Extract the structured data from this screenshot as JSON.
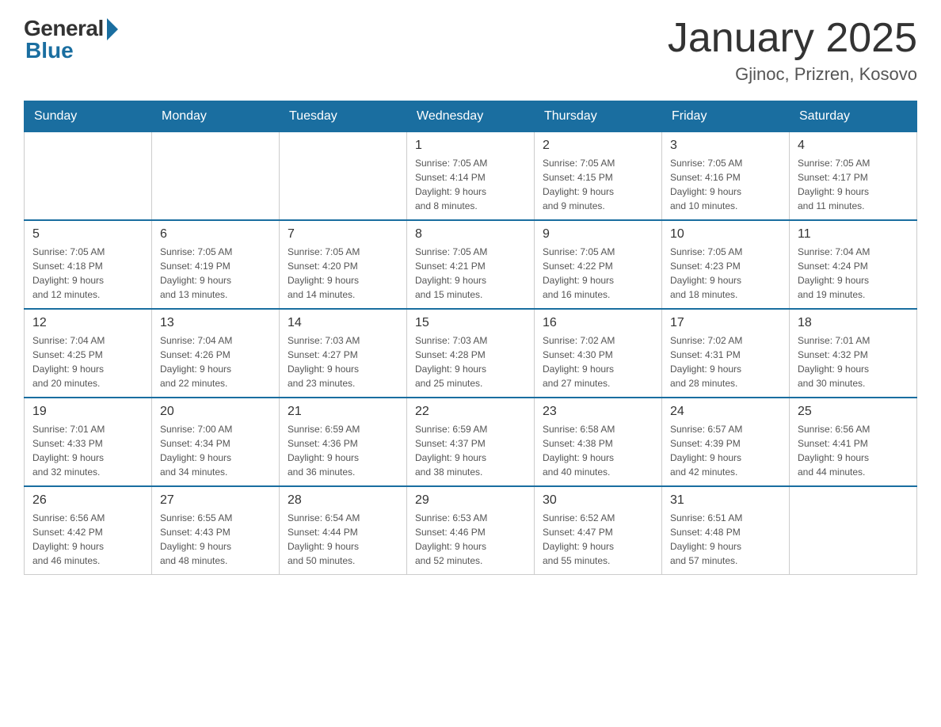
{
  "logo": {
    "general": "General",
    "blue": "Blue"
  },
  "title": "January 2025",
  "location": "Gjinoc, Prizren, Kosovo",
  "days_of_week": [
    "Sunday",
    "Monday",
    "Tuesday",
    "Wednesday",
    "Thursday",
    "Friday",
    "Saturday"
  ],
  "weeks": [
    [
      {
        "day": "",
        "info": ""
      },
      {
        "day": "",
        "info": ""
      },
      {
        "day": "",
        "info": ""
      },
      {
        "day": "1",
        "info": "Sunrise: 7:05 AM\nSunset: 4:14 PM\nDaylight: 9 hours\nand 8 minutes."
      },
      {
        "day": "2",
        "info": "Sunrise: 7:05 AM\nSunset: 4:15 PM\nDaylight: 9 hours\nand 9 minutes."
      },
      {
        "day": "3",
        "info": "Sunrise: 7:05 AM\nSunset: 4:16 PM\nDaylight: 9 hours\nand 10 minutes."
      },
      {
        "day": "4",
        "info": "Sunrise: 7:05 AM\nSunset: 4:17 PM\nDaylight: 9 hours\nand 11 minutes."
      }
    ],
    [
      {
        "day": "5",
        "info": "Sunrise: 7:05 AM\nSunset: 4:18 PM\nDaylight: 9 hours\nand 12 minutes."
      },
      {
        "day": "6",
        "info": "Sunrise: 7:05 AM\nSunset: 4:19 PM\nDaylight: 9 hours\nand 13 minutes."
      },
      {
        "day": "7",
        "info": "Sunrise: 7:05 AM\nSunset: 4:20 PM\nDaylight: 9 hours\nand 14 minutes."
      },
      {
        "day": "8",
        "info": "Sunrise: 7:05 AM\nSunset: 4:21 PM\nDaylight: 9 hours\nand 15 minutes."
      },
      {
        "day": "9",
        "info": "Sunrise: 7:05 AM\nSunset: 4:22 PM\nDaylight: 9 hours\nand 16 minutes."
      },
      {
        "day": "10",
        "info": "Sunrise: 7:05 AM\nSunset: 4:23 PM\nDaylight: 9 hours\nand 18 minutes."
      },
      {
        "day": "11",
        "info": "Sunrise: 7:04 AM\nSunset: 4:24 PM\nDaylight: 9 hours\nand 19 minutes."
      }
    ],
    [
      {
        "day": "12",
        "info": "Sunrise: 7:04 AM\nSunset: 4:25 PM\nDaylight: 9 hours\nand 20 minutes."
      },
      {
        "day": "13",
        "info": "Sunrise: 7:04 AM\nSunset: 4:26 PM\nDaylight: 9 hours\nand 22 minutes."
      },
      {
        "day": "14",
        "info": "Sunrise: 7:03 AM\nSunset: 4:27 PM\nDaylight: 9 hours\nand 23 minutes."
      },
      {
        "day": "15",
        "info": "Sunrise: 7:03 AM\nSunset: 4:28 PM\nDaylight: 9 hours\nand 25 minutes."
      },
      {
        "day": "16",
        "info": "Sunrise: 7:02 AM\nSunset: 4:30 PM\nDaylight: 9 hours\nand 27 minutes."
      },
      {
        "day": "17",
        "info": "Sunrise: 7:02 AM\nSunset: 4:31 PM\nDaylight: 9 hours\nand 28 minutes."
      },
      {
        "day": "18",
        "info": "Sunrise: 7:01 AM\nSunset: 4:32 PM\nDaylight: 9 hours\nand 30 minutes."
      }
    ],
    [
      {
        "day": "19",
        "info": "Sunrise: 7:01 AM\nSunset: 4:33 PM\nDaylight: 9 hours\nand 32 minutes."
      },
      {
        "day": "20",
        "info": "Sunrise: 7:00 AM\nSunset: 4:34 PM\nDaylight: 9 hours\nand 34 minutes."
      },
      {
        "day": "21",
        "info": "Sunrise: 6:59 AM\nSunset: 4:36 PM\nDaylight: 9 hours\nand 36 minutes."
      },
      {
        "day": "22",
        "info": "Sunrise: 6:59 AM\nSunset: 4:37 PM\nDaylight: 9 hours\nand 38 minutes."
      },
      {
        "day": "23",
        "info": "Sunrise: 6:58 AM\nSunset: 4:38 PM\nDaylight: 9 hours\nand 40 minutes."
      },
      {
        "day": "24",
        "info": "Sunrise: 6:57 AM\nSunset: 4:39 PM\nDaylight: 9 hours\nand 42 minutes."
      },
      {
        "day": "25",
        "info": "Sunrise: 6:56 AM\nSunset: 4:41 PM\nDaylight: 9 hours\nand 44 minutes."
      }
    ],
    [
      {
        "day": "26",
        "info": "Sunrise: 6:56 AM\nSunset: 4:42 PM\nDaylight: 9 hours\nand 46 minutes."
      },
      {
        "day": "27",
        "info": "Sunrise: 6:55 AM\nSunset: 4:43 PM\nDaylight: 9 hours\nand 48 minutes."
      },
      {
        "day": "28",
        "info": "Sunrise: 6:54 AM\nSunset: 4:44 PM\nDaylight: 9 hours\nand 50 minutes."
      },
      {
        "day": "29",
        "info": "Sunrise: 6:53 AM\nSunset: 4:46 PM\nDaylight: 9 hours\nand 52 minutes."
      },
      {
        "day": "30",
        "info": "Sunrise: 6:52 AM\nSunset: 4:47 PM\nDaylight: 9 hours\nand 55 minutes."
      },
      {
        "day": "31",
        "info": "Sunrise: 6:51 AM\nSunset: 4:48 PM\nDaylight: 9 hours\nand 57 minutes."
      },
      {
        "day": "",
        "info": ""
      }
    ]
  ]
}
